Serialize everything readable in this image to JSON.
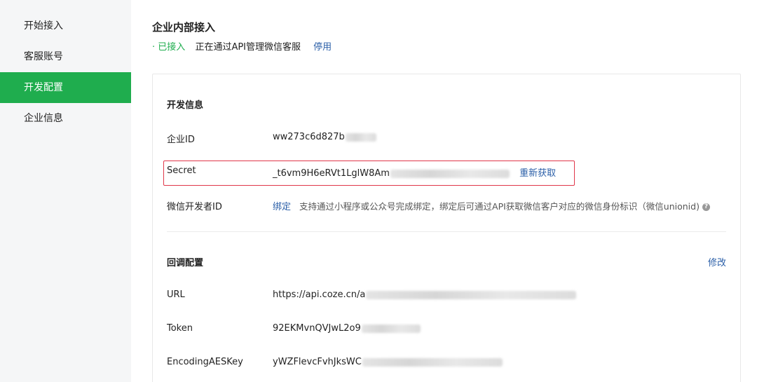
{
  "sidebar": {
    "items": [
      {
        "label": "开始接入"
      },
      {
        "label": "客服账号"
      },
      {
        "label": "开发配置"
      },
      {
        "label": "企业信息"
      }
    ]
  },
  "header": {
    "title": "企业内部接入",
    "status_dot": "·",
    "status_text": "已接入",
    "status_desc": "正在通过API管理微信客服",
    "disable_link": "停用"
  },
  "dev_info": {
    "section_title": "开发信息",
    "corp_id_label": "企业ID",
    "corp_id_value": "ww273c6d827b",
    "secret_label": "Secret",
    "secret_value": "_t6vm9H6eRVt1LglW8Am",
    "refresh_link": "重新获取",
    "wechat_dev_id_label": "微信开发者ID",
    "bind_link": "绑定",
    "bind_hint": "支持通过小程序或公众号完成绑定，绑定后可通过API获取微信客户对应的微信身份标识（微信unionid)",
    "help_icon": "?"
  },
  "callback": {
    "section_title": "回调配置",
    "edit_link": "修改",
    "url_label": "URL",
    "url_value": "https://api.coze.cn/a",
    "token_label": "Token",
    "token_value": "92EKMvnQVJwL2o9",
    "aes_label": "EncodingAESKey",
    "aes_value": "yWZFlevcFvhJksWC"
  },
  "colors": {
    "accent": "#1fad4e",
    "link": "#2b5fa8",
    "highlight_border": "#e0374a",
    "sidebar_bg": "#f5f6f7"
  }
}
